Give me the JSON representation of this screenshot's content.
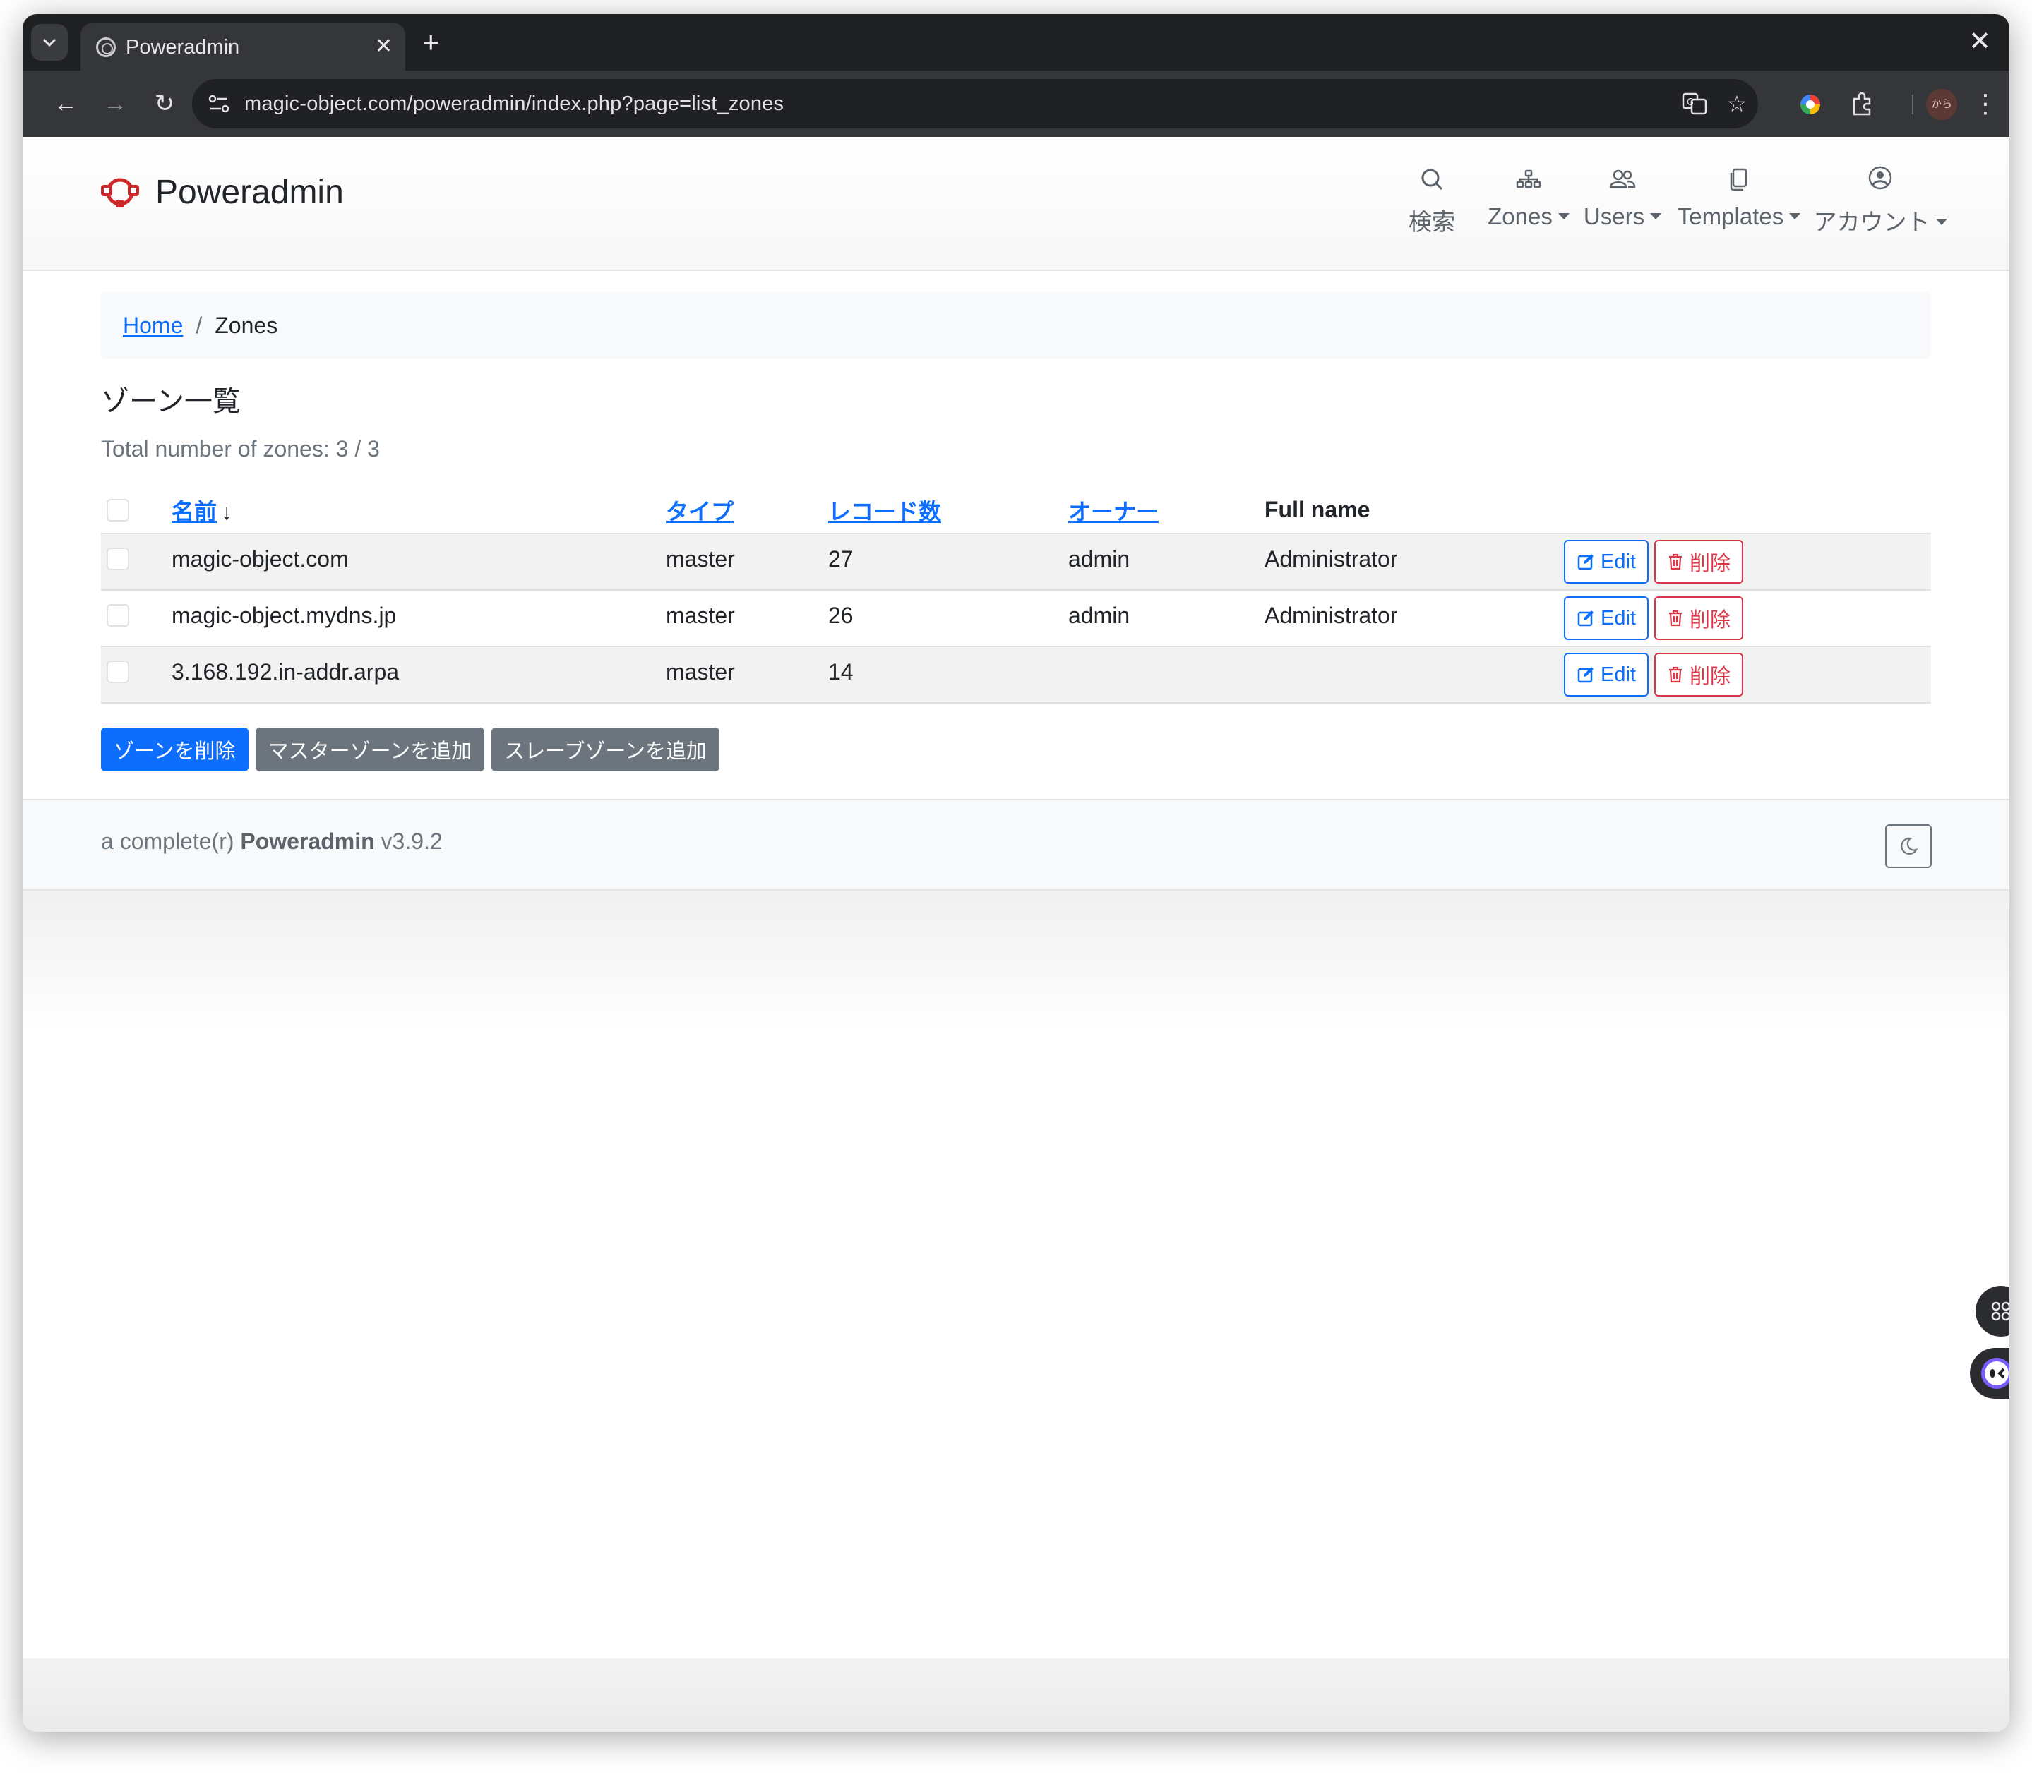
{
  "browser": {
    "tab_title": "Poweradmin",
    "url": "magic-object.com/poweradmin/index.php?page=list_zones",
    "profile_label": "から"
  },
  "nav": {
    "brand": "Poweradmin",
    "items": [
      {
        "label": "検索",
        "icon": "search-icon"
      },
      {
        "label": "Zones",
        "icon": "sitemap-icon"
      },
      {
        "label": "Users",
        "icon": "users-icon"
      },
      {
        "label": "Templates",
        "icon": "copy-icon"
      },
      {
        "label": "アカウント",
        "icon": "user-circle-icon"
      }
    ]
  },
  "breadcrumb": {
    "home": "Home",
    "separator": "/",
    "current": "Zones"
  },
  "page_title": "ゾーン一覧",
  "total_zones": "Total number of zones: 3 / 3",
  "table": {
    "headers": {
      "name": "名前",
      "sort_arrow": "↓",
      "type": "タイプ",
      "records": "レコード数",
      "owner": "オーナー",
      "fullname": "Full name"
    },
    "rows": [
      {
        "name": "magic-object.com",
        "type": "master",
        "records": "27",
        "owner": "admin",
        "fullname": "Administrator"
      },
      {
        "name": "magic-object.mydns.jp",
        "type": "master",
        "records": "26",
        "owner": "admin",
        "fullname": "Administrator"
      },
      {
        "name": "3.168.192.in-addr.arpa",
        "type": "master",
        "records": "14",
        "owner": "",
        "fullname": ""
      }
    ],
    "edit_label": "Edit",
    "delete_label": "削除"
  },
  "actions": {
    "delete_zones": "ゾーンを削除",
    "add_master": "マスターゾーンを追加",
    "add_slave": "スレーブゾーンを追加"
  },
  "footer": {
    "prefix": "a complete(r) ",
    "brand": "Poweradmin",
    "version": " v3.9.2"
  },
  "colors": {
    "primary": "#0d6efd",
    "danger": "#dc3545",
    "secondary": "#6c757d",
    "brand_red": "#d0282a"
  }
}
